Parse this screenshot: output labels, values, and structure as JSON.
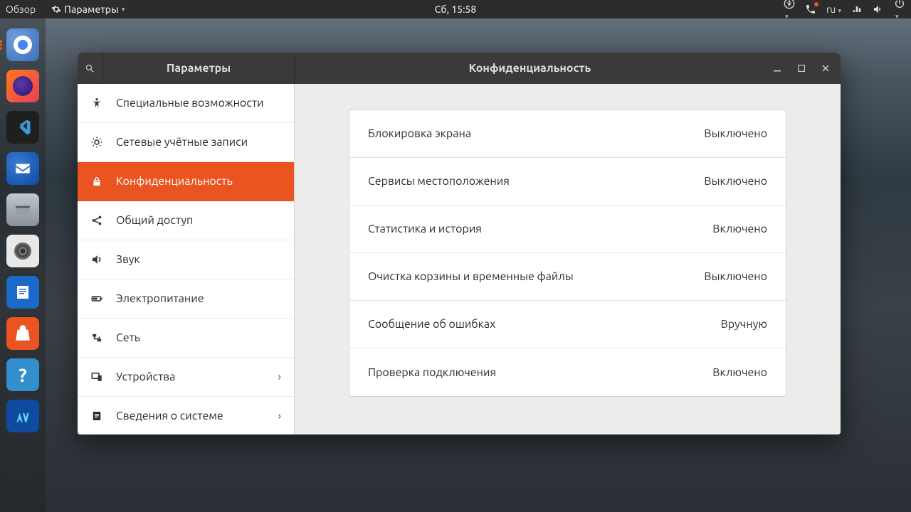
{
  "panel": {
    "activities": "Обзор",
    "app_menu": "Параметры",
    "clock": "Сб, 15:58",
    "lang": "ru"
  },
  "dock": [
    {
      "name": "chrome",
      "label": "Chromium"
    },
    {
      "name": "firefox",
      "label": "Firefox"
    },
    {
      "name": "vscode",
      "label": "Visual Studio Code"
    },
    {
      "name": "thunderbird",
      "label": "Thunderbird"
    },
    {
      "name": "files",
      "label": "Файлы"
    },
    {
      "name": "rhythmbox",
      "label": "Rhythmbox"
    },
    {
      "name": "writer",
      "label": "LibreOffice Writer"
    },
    {
      "name": "software",
      "label": "Ubuntu Software"
    },
    {
      "name": "help",
      "label": "Справка"
    },
    {
      "name": "vm",
      "label": "VirtualBox"
    }
  ],
  "window": {
    "left_title": "Параметры",
    "right_title": "Конфиденциальность",
    "sidebar": [
      {
        "label": "Специальные возможности",
        "icon": "a11y"
      },
      {
        "label": "Сетевые учётные записи",
        "icon": "accounts"
      },
      {
        "label": "Конфиденциальность",
        "icon": "privacy",
        "active": true
      },
      {
        "label": "Общий доступ",
        "icon": "share"
      },
      {
        "label": "Звук",
        "icon": "sound"
      },
      {
        "label": "Электропитание",
        "icon": "power"
      },
      {
        "label": "Сеть",
        "icon": "network"
      },
      {
        "label": "Устройства",
        "icon": "devices",
        "chevron": true
      },
      {
        "label": "Сведения о системе",
        "icon": "info",
        "chevron": true
      }
    ],
    "rows": [
      {
        "label": "Блокировка экрана",
        "value": "Выключено"
      },
      {
        "label": "Сервисы местоположения",
        "value": "Выключено"
      },
      {
        "label": "Статистика и история",
        "value": "Включено"
      },
      {
        "label": "Очистка корзины и временные файлы",
        "value": "Выключено"
      },
      {
        "label": "Сообщение об ошибках",
        "value": "Вручную"
      },
      {
        "label": "Проверка подключения",
        "value": "Включено"
      }
    ]
  }
}
